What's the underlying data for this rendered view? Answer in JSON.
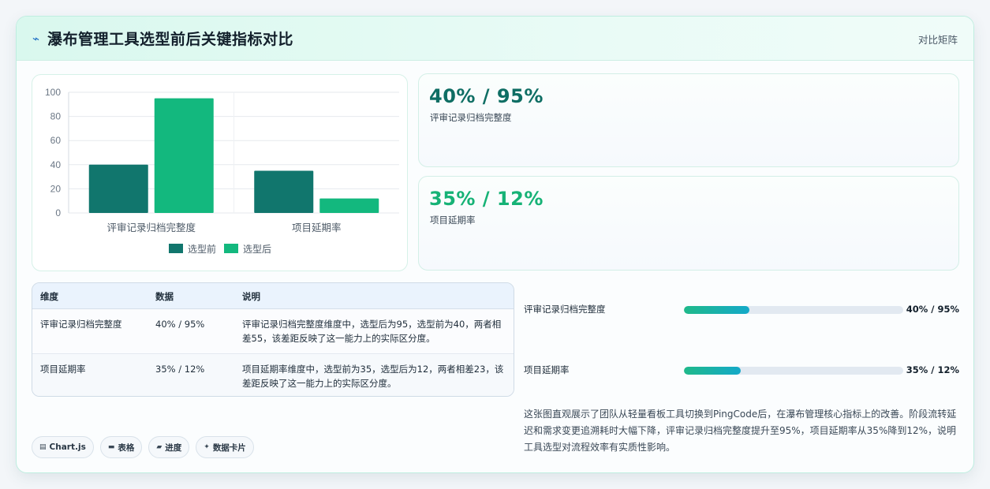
{
  "header": {
    "icon": "lightning-icon",
    "title": "瀑布管理工具选型前后关键指标对比",
    "right_label": "对比矩阵"
  },
  "colors": {
    "before": "#11766d",
    "after": "#13b87e",
    "kpi1": "#0f6e64",
    "kpi2": "#16b276"
  },
  "chart_data": {
    "type": "bar",
    "categories": [
      "评审记录归档完整度",
      "项目延期率"
    ],
    "series": [
      {
        "name": "选型前",
        "values": [
          40,
          35
        ],
        "color": "#11766d"
      },
      {
        "name": "选型后",
        "values": [
          95,
          12
        ],
        "color": "#13b87e"
      }
    ],
    "yticks": [
      "0",
      "20",
      "40",
      "60",
      "80",
      "100"
    ],
    "ylim": [
      0,
      100
    ],
    "grid": true,
    "legend": "bottom"
  },
  "kpis": [
    {
      "value": "40% / 95%",
      "label": "评审记录归档完整度"
    },
    {
      "value": "35% / 12%",
      "label": "项目延期率"
    }
  ],
  "table": {
    "headers": [
      "维度",
      "数据",
      "说明"
    ],
    "rows": [
      {
        "dim": "评审记录归档完整度",
        "data": "40% / 95%",
        "desc": "评审记录归档完整度维度中，选型后为95，选型前为40，两者相差55，该差距反映了这一能力上的实际区分度。"
      },
      {
        "dim": "项目延期率",
        "data": "35% / 12%",
        "desc": "项目延期率维度中，选型前为35，选型后为12，两者相差23，该差距反映了这一能力上的实际区分度。"
      }
    ]
  },
  "progress": [
    {
      "label": "评审记录归档完整度",
      "value_text": "40% / 95%",
      "fill": 0.3
    },
    {
      "label": "项目延期率",
      "value_text": "35% / 12%",
      "fill": 0.26
    }
  ],
  "summary": "这张图直观展示了团队从轻量看板工具切换到PingCode后，在瀑布管理核心指标上的改善。阶段流转延迟和需求变更追溯耗时大幅下降，评审记录归档完整度提升至95%，项目延期率从35%降到12%，说明工具选型对流程效率有实质性影响。",
  "chips": [
    {
      "icon": "chart-icon",
      "label": "Chart.js"
    },
    {
      "icon": "table-icon",
      "label": "表格"
    },
    {
      "icon": "progress-icon",
      "label": "进度"
    },
    {
      "icon": "sparkle-icon",
      "label": "数据卡片"
    }
  ]
}
